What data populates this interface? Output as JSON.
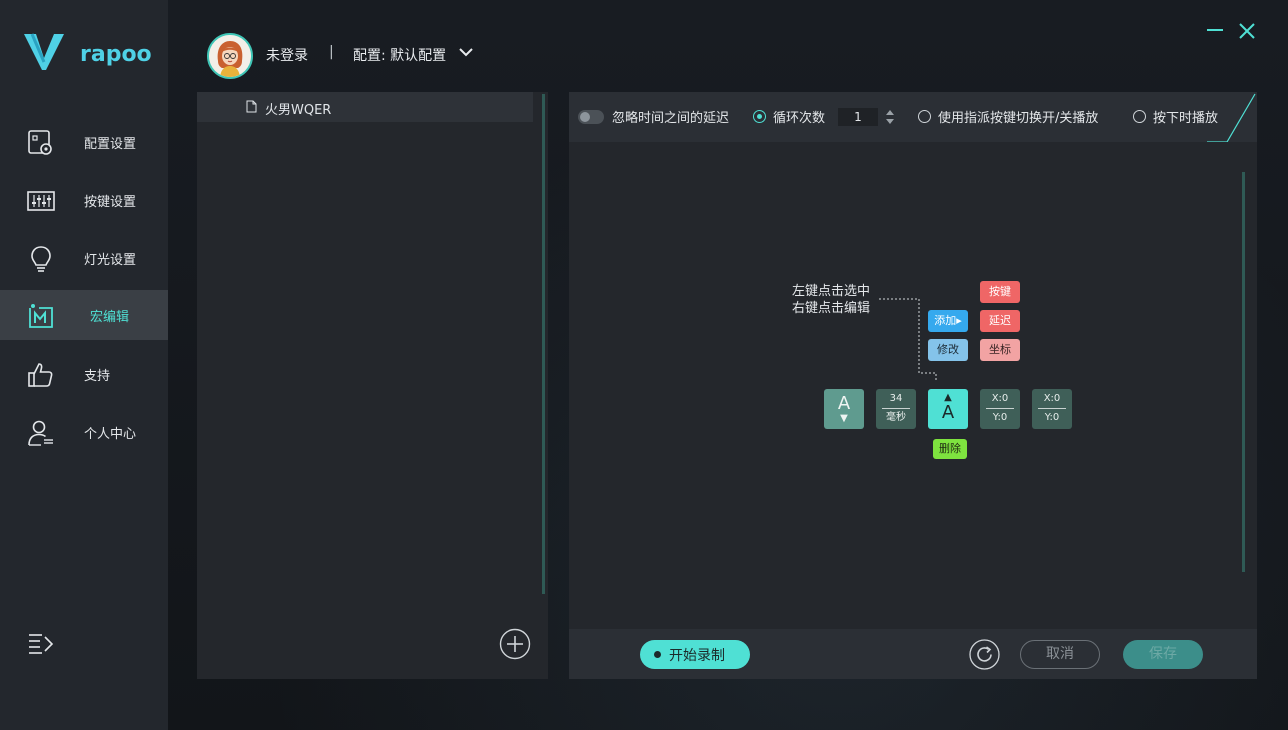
{
  "brand": {
    "name": "rapoo",
    "accent": "#4fd1e6"
  },
  "sidebar": {
    "items": [
      {
        "label": "配置设置",
        "icon": "config-settings-icon"
      },
      {
        "label": "按键设置",
        "icon": "key-settings-icon"
      },
      {
        "label": "灯光设置",
        "icon": "lightbulb-icon"
      },
      {
        "label": "宏编辑",
        "icon": "macro-edit-icon",
        "active": true
      },
      {
        "label": "支持",
        "icon": "thumbs-up-icon"
      },
      {
        "label": "个人中心",
        "icon": "user-center-icon"
      }
    ],
    "collapse_icon": "menu-collapse-icon"
  },
  "header": {
    "user": "未登录",
    "separator": "|",
    "profile": "配置: 默认配置"
  },
  "macro_list": {
    "items": [
      {
        "name": "火男WQER"
      }
    ]
  },
  "toolbar": {
    "ignore_delay": "忽略时间之间的延迟",
    "loop_count": "循环次数",
    "loop_value": "1",
    "toggle_play": "使用指派按键切换开/关播放",
    "hold_play": "按下时播放",
    "selected_mode": "loop"
  },
  "editor": {
    "hint_line1": "左键点击选中",
    "hint_line2": "右键点击编辑",
    "menu": {
      "add": "添加▸",
      "modify": "修改",
      "key": "按键",
      "delay": "延迟",
      "coord": "坐标",
      "delete": "删除"
    },
    "events": [
      {
        "kind": "key-down",
        "key": "A",
        "arrow": "▼"
      },
      {
        "kind": "delay",
        "value": "34",
        "unit": "毫秒"
      },
      {
        "kind": "key-up",
        "key": "A",
        "arrow": "▲"
      },
      {
        "kind": "coord",
        "x": "X:0",
        "y": "Y:0"
      },
      {
        "kind": "coord",
        "x": "X:0",
        "y": "Y:0"
      }
    ]
  },
  "bottom": {
    "record": "开始录制",
    "cancel": "取消",
    "save": "保存"
  },
  "colors": {
    "accent": "#4fe0d4",
    "key_red": "#ef6666",
    "coord_pink": "#f2a3a3",
    "add_blue": "#35a9ee",
    "modify_blue": "#84c3ea",
    "delete_green": "#7ee33f"
  }
}
